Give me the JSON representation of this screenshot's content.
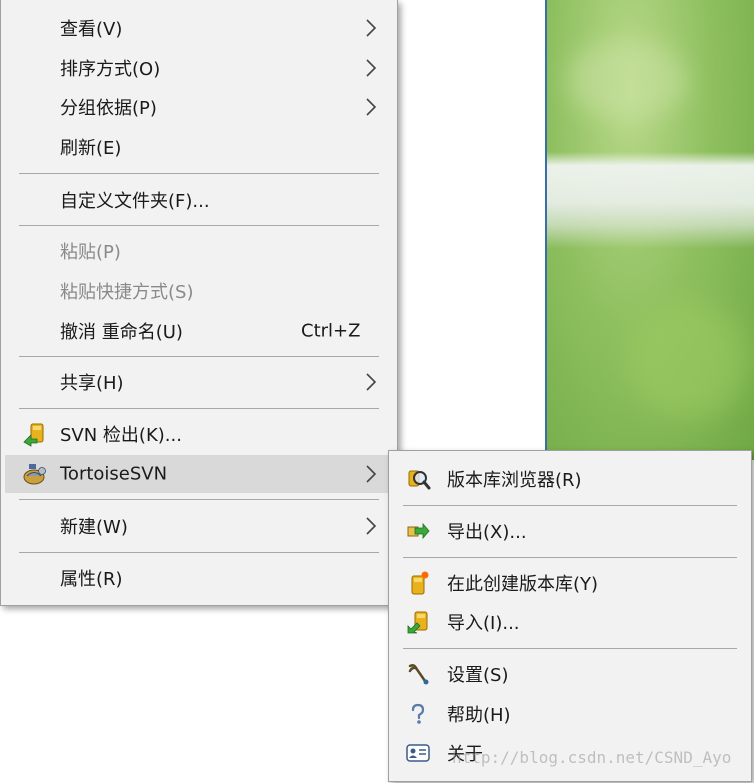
{
  "main_menu": {
    "view": "查看(V)",
    "sort_by": "排序方式(O)",
    "group_by": "分组依据(P)",
    "refresh": "刷新(E)",
    "customize_folder": "自定义文件夹(F)...",
    "paste": "粘贴(P)",
    "paste_shortcut": "粘贴快捷方式(S)",
    "undo_rename": "撤消 重命名(U)",
    "undo_shortcut": "Ctrl+Z",
    "share": "共享(H)",
    "svn_checkout": "SVN 检出(K)...",
    "tortoise_svn": "TortoiseSVN",
    "new": "新建(W)",
    "properties": "属性(R)"
  },
  "sub_menu": {
    "repo_browser": "版本库浏览器(R)",
    "export": "导出(X)...",
    "create_repo_here": "在此创建版本库(Y)",
    "import": "导入(I)...",
    "settings": "设置(S)",
    "help": "帮助(H)",
    "about": "关于"
  },
  "watermark": "http://blog.csdn.net/CSND_Ayo",
  "icons": {
    "arrow": "chevron-right-icon",
    "svn_checkout": "svn-checkout-icon",
    "tortoise_svn": "tortoise-svn-icon",
    "repo_browser": "repo-browser-icon",
    "export": "export-icon",
    "create_repo": "create-repo-icon",
    "import": "import-icon",
    "settings": "settings-icon",
    "help": "help-icon",
    "about": "about-icon"
  },
  "colors": {
    "menu_bg": "#f2f2f2",
    "highlight_bg": "#d9d9d9",
    "disabled_text": "#8a8a8a",
    "separator": "#a8a8a8"
  }
}
